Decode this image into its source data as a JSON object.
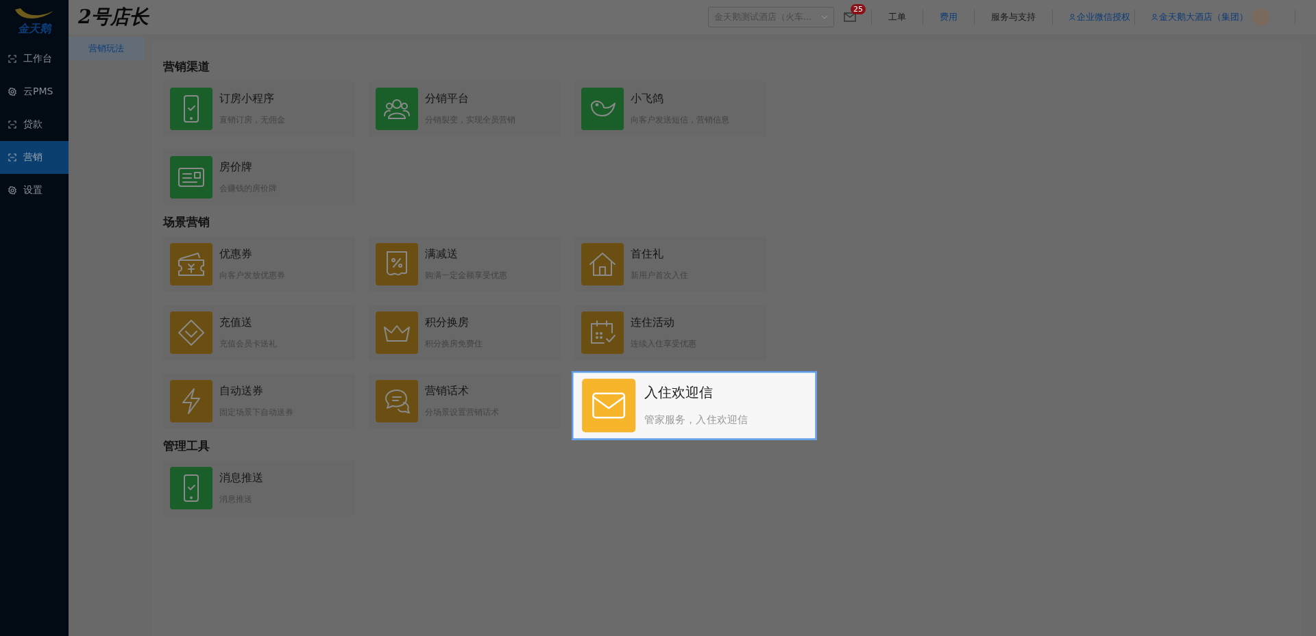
{
  "sidebar": {
    "logo": "金天鹅",
    "items": [
      {
        "label": "工作台",
        "kind": "frame",
        "selected": false
      },
      {
        "label": "云PMS",
        "kind": "gear",
        "selected": false
      },
      {
        "label": "贷款",
        "kind": "frame",
        "selected": false
      },
      {
        "label": "营销",
        "kind": "frame",
        "selected": true
      },
      {
        "label": "设置",
        "kind": "gear",
        "selected": false
      }
    ]
  },
  "header": {
    "app_title": "2号店长",
    "hotel_select": "金天鹅测试酒店（火车...",
    "mail_badge": "25",
    "links": [
      {
        "label": "工单",
        "kind": "text"
      },
      {
        "label": "费用",
        "kind": "link"
      },
      {
        "label": "服务与支持",
        "kind": "text"
      },
      {
        "label": "企业微信授权",
        "kind": "user"
      },
      {
        "label": "金天鹅大酒店（集团）",
        "kind": "user"
      }
    ]
  },
  "subnav": [
    {
      "label": "营销玩法",
      "selected": true
    }
  ],
  "sections": [
    {
      "title": "营销渠道",
      "cards": [
        {
          "title": "订房小程序",
          "desc": "直销订房，无佣金",
          "kind": "phone",
          "color": "#1a5e2a",
          "highlighted": false
        },
        {
          "title": "分销平台",
          "desc": "分销裂变，实现全员营销",
          "kind": "people",
          "color": "#1a5e2a",
          "highlighted": false
        },
        {
          "title": "小飞鸽",
          "desc": "向客户发送短信，营销信息",
          "kind": "bird",
          "color": "#1a5e2a",
          "highlighted": false
        },
        {
          "title": "房价牌",
          "desc": "会赚钱的房价牌",
          "kind": "board",
          "color": "#1a5e2a",
          "highlighted": false
        }
      ]
    },
    {
      "title": "场景营销",
      "cards": [
        {
          "title": "优惠券",
          "desc": "向客户发放优惠券",
          "kind": "coupon",
          "color": "#6b4f12",
          "highlighted": false
        },
        {
          "title": "满减送",
          "desc": "购满一定金额享受优惠",
          "kind": "percent",
          "color": "#6b4f12",
          "highlighted": false
        },
        {
          "title": "首住礼",
          "desc": "新用户首次入住",
          "kind": "house",
          "color": "#6b4f12",
          "highlighted": false
        },
        {
          "title": "充值送",
          "desc": "充值会员卡送礼",
          "kind": "diamond",
          "color": "#6b4f12",
          "highlighted": false
        },
        {
          "title": "积分换房",
          "desc": "积分换房免费住",
          "kind": "crown",
          "color": "#6b4f12",
          "highlighted": false
        },
        {
          "title": "连住活动",
          "desc": "连续入住享受优惠",
          "kind": "calendar",
          "color": "#6b4f12",
          "highlighted": false
        },
        {
          "title": "自动送券",
          "desc": "固定场景下自动送券",
          "kind": "bolt",
          "color": "#6b4f12",
          "highlighted": false
        },
        {
          "title": "营销话术",
          "desc": "分场景设置营销话术",
          "kind": "chat",
          "color": "#6b4f12",
          "highlighted": false
        },
        {
          "title": "入住欢迎信",
          "desc": "管家服务，入住欢迎信",
          "kind": "mail",
          "color": "#f7b52c",
          "highlighted": true
        }
      ]
    },
    {
      "title": "管理工具",
      "cards": [
        {
          "title": "消息推送",
          "desc": "消息推送",
          "kind": "phone",
          "color": "#1a5e2a",
          "highlighted": false
        }
      ]
    }
  ]
}
